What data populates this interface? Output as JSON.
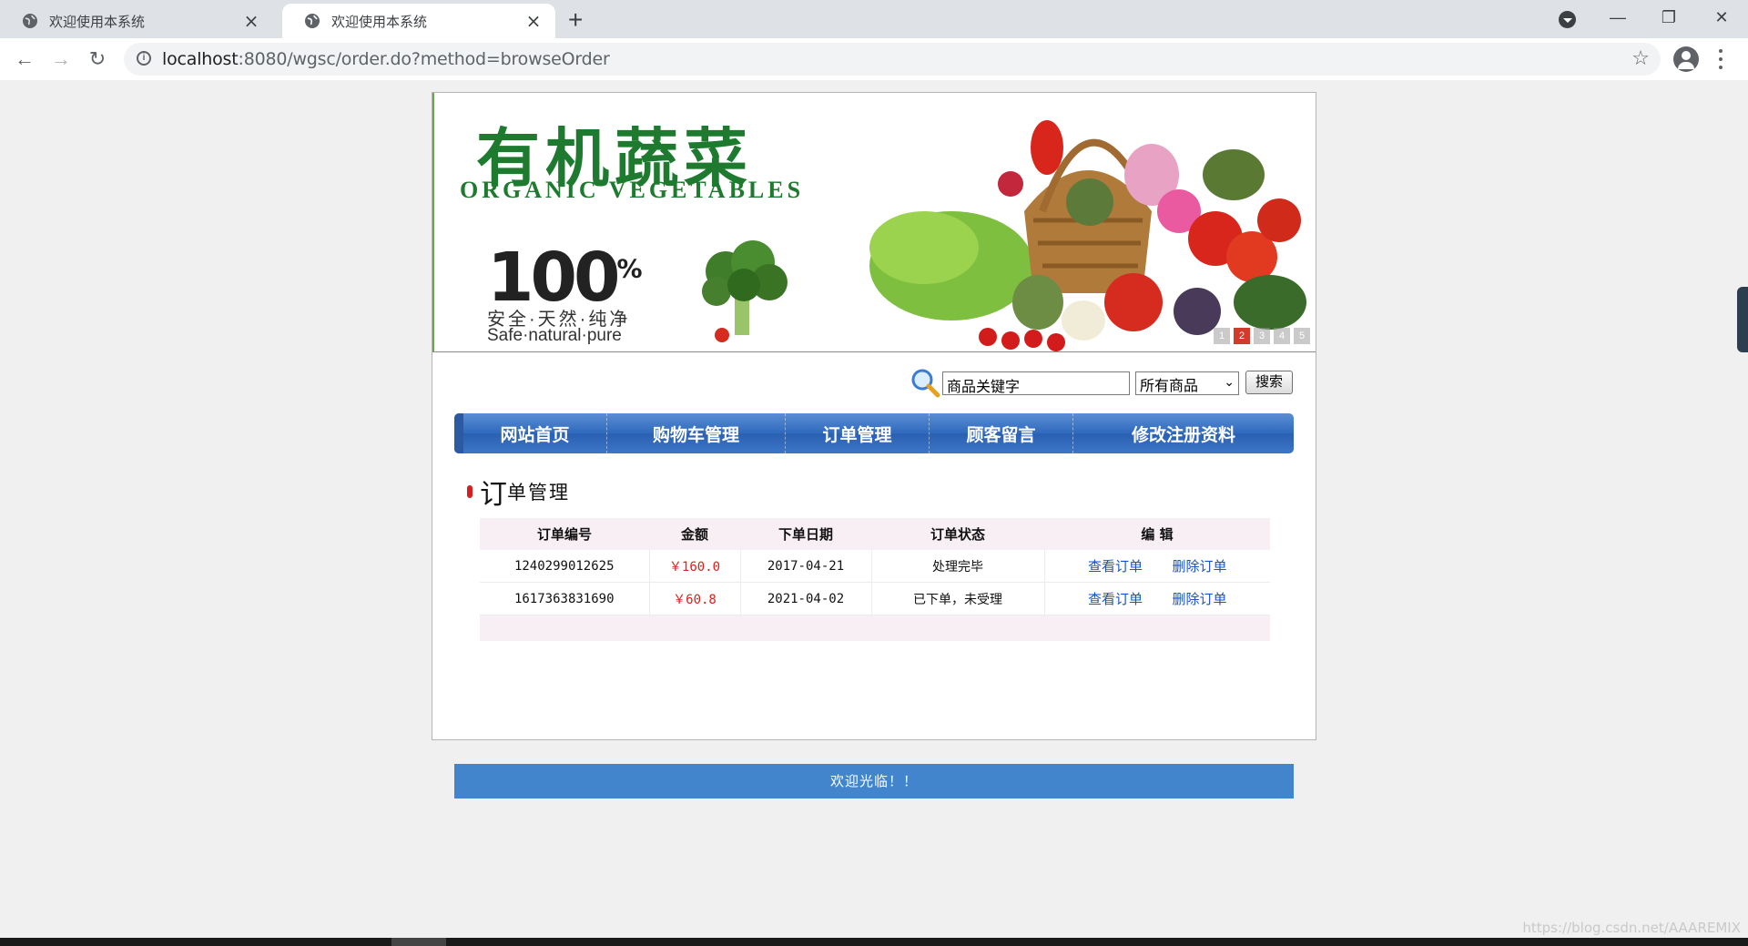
{
  "browser": {
    "tabs": [
      {
        "title": "欢迎使用本系统",
        "active": false
      },
      {
        "title": "欢迎使用本系统",
        "active": true
      }
    ],
    "new_tab_symbol": "+",
    "url_host": "localhost",
    "url_path": ":8080/wgsc/order.do?method=browseOrder",
    "window_controls": {
      "minimize": "—",
      "restore": "❐",
      "close": "✕"
    }
  },
  "banner": {
    "logo_cn": "有机蔬菜",
    "logo_en": "ORGANIC VEGETABLES",
    "hundred": "100",
    "percent": "%",
    "slogan_cn": "安全·天然·纯净",
    "slogan_en": "Safe·natural·pure",
    "slides": [
      "1",
      "2",
      "3",
      "4",
      "5"
    ]
  },
  "search": {
    "value": "商品关键字",
    "category": "所有商品",
    "button": "搜索"
  },
  "nav": [
    "网站首页",
    "购物车管理",
    "订单管理",
    "顾客留言",
    "修改注册资料"
  ],
  "section": {
    "first_char": "订",
    "rest": "单管理"
  },
  "orders": {
    "headers": [
      "订单编号",
      "金额",
      "下单日期",
      "订单状态",
      "编 辑"
    ],
    "rows": [
      {
        "id": "1240299012625",
        "amount": "￥160.0",
        "date": "2017-04-21",
        "status": "处理完毕",
        "view": "查看订单",
        "delete": "删除订单"
      },
      {
        "id": "1617363831690",
        "amount": "￥60.8",
        "date": "2021-04-02",
        "status": "已下单，未受理",
        "view": "查看订单",
        "delete": "删除订单"
      }
    ]
  },
  "footer": "欢迎光临！！",
  "watermark": "https://blog.csdn.net/AAAREMIX",
  "colors": {
    "nav_blue": "#2f69bd",
    "footer_blue": "#4285cd",
    "price_red": "#e0201c",
    "link_blue": "#1a52c8",
    "brand_green": "#1e7a2e"
  }
}
